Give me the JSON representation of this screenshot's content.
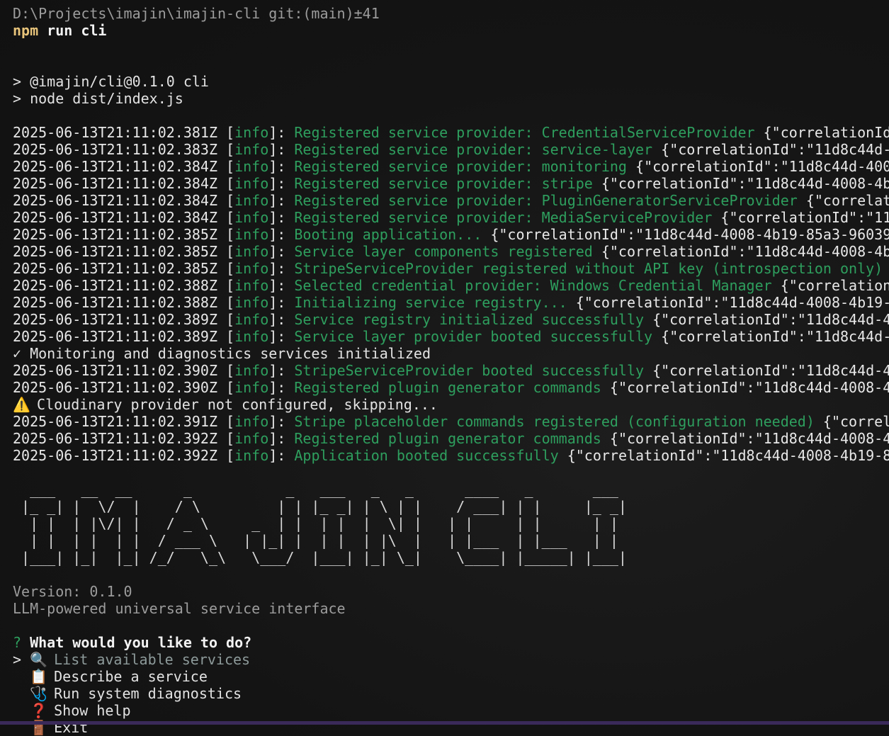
{
  "prompt": {
    "path": "D:\\Projects\\imajin\\imajin-cli git:(main)±41",
    "command_bin": "npm",
    "command_args": " run cli"
  },
  "npm_output": [
    "> @imajin/cli@0.1.0 cli",
    "> node dist/index.js"
  ],
  "logs": [
    {
      "ts": "2025-06-13T21:11:02.381Z",
      "level": "info",
      "msg": "Registered service provider: CredentialServiceProvider",
      "json": " {\"correlationId"
    },
    {
      "ts": "2025-06-13T21:11:02.383Z",
      "level": "info",
      "msg": "Registered service provider: service-layer",
      "json": " {\"correlationId\":\"11d8c44d-"
    },
    {
      "ts": "2025-06-13T21:11:02.384Z",
      "level": "info",
      "msg": "Registered service provider: monitoring",
      "json": " {\"correlationId\":\"11d8c44d-400"
    },
    {
      "ts": "2025-06-13T21:11:02.384Z",
      "level": "info",
      "msg": "Registered service provider: stripe",
      "json": " {\"correlationId\":\"11d8c44d-4008-4b"
    },
    {
      "ts": "2025-06-13T21:11:02.384Z",
      "level": "info",
      "msg": "Registered service provider: PluginGeneratorServiceProvider",
      "json": " {\"correlat"
    },
    {
      "ts": "2025-06-13T21:11:02.384Z",
      "level": "info",
      "msg": "Registered service provider: MediaServiceProvider",
      "json": " {\"correlationId\":\"11"
    },
    {
      "ts": "2025-06-13T21:11:02.385Z",
      "level": "info",
      "msg": "Booting application...",
      "json": " {\"correlationId\":\"11d8c44d-4008-4b19-85a3-96039"
    },
    {
      "ts": "2025-06-13T21:11:02.385Z",
      "level": "info",
      "msg": "Service layer components registered",
      "json": " {\"correlationId\":\"11d8c44d-4008-4b"
    },
    {
      "ts": "2025-06-13T21:11:02.385Z",
      "level": "info",
      "msg": "StripeServiceProvider registered without API key (introspection only)",
      "json": " {"
    },
    {
      "ts": "2025-06-13T21:11:02.388Z",
      "level": "info",
      "msg": "Selected credential provider: Windows Credential Manager",
      "json": " {\"correlation"
    },
    {
      "ts": "2025-06-13T21:11:02.388Z",
      "level": "info",
      "msg": "Initializing service registry...",
      "json": " {\"correlationId\":\"11d8c44d-4008-4b19-"
    },
    {
      "ts": "2025-06-13T21:11:02.389Z",
      "level": "info",
      "msg": "Service registry initialized successfully",
      "json": " {\"correlationId\":\"11d8c44d-4"
    },
    {
      "ts": "2025-06-13T21:11:02.389Z",
      "level": "info",
      "msg": "Service layer provider booted successfully",
      "json": " {\"correlationId\":\"11d8c44d-"
    }
  ],
  "monitor_line": "✓ Monitoring and diagnostics services initialized",
  "logs2": [
    {
      "ts": "2025-06-13T21:11:02.390Z",
      "level": "info",
      "msg": "StripeServiceProvider booted successfully",
      "json": " {\"correlationId\":\"11d8c44d-4"
    },
    {
      "ts": "2025-06-13T21:11:02.390Z",
      "level": "info",
      "msg": "Registered plugin generator commands",
      "json": " {\"correlationId\":\"11d8c44d-4008-4"
    }
  ],
  "warning_icon": "⚠️",
  "warning_text": " Cloudinary provider not configured, skipping...",
  "logs3": [
    {
      "ts": "2025-06-13T21:11:02.391Z",
      "level": "info",
      "msg": "Stripe placeholder commands registered (configuration needed)",
      "json": " {\"correl"
    },
    {
      "ts": "2025-06-13T21:11:02.392Z",
      "level": "info",
      "msg": "Registered plugin generator commands",
      "json": " {\"correlationId\":\"11d8c44d-4008-4"
    },
    {
      "ts": "2025-06-13T21:11:02.392Z",
      "level": "info",
      "msg": "Application booted successfully",
      "json": " {\"correlationId\":\"11d8c44d-4008-4b19-8"
    }
  ],
  "banner_lines": [
    "  ___   __  __      _           _   ___   _   _      ____   _       ___ ",
    " |_ _| |  \\/  |    / \\         | | |_ _| | \\ | |    / ___| | |     |_ _|",
    "  | |  | |\\/| |   / _ \\     _  | |  | |  |  \\| |   | |     | |      | | ",
    "  | |  | |  | |  / ___ \\   | |_| |  | |  | |\\  |   | |___  | |___   | | ",
    " |___| |_|  |_| /_/   \\_\\   \\___/  |___| |_| \\_|    \\____| |_____| |___|"
  ],
  "version": "Version: 0.1.0",
  "tagline": "LLM-powered universal service interface",
  "question_mark": "?",
  "question": " What would you like to do?",
  "menu": [
    {
      "pointer": ">",
      "icon": "🔍",
      "icon_name": "magnifier-icon",
      "label": "List available services",
      "selected": true
    },
    {
      "pointer": " ",
      "icon": "📋",
      "icon_name": "clipboard-icon",
      "label": "Describe a service",
      "selected": false
    },
    {
      "pointer": " ",
      "icon": "🩺",
      "icon_name": "stethoscope-icon",
      "label": "Run system diagnostics",
      "selected": false
    },
    {
      "pointer": " ",
      "icon": "❓",
      "icon_name": "question-icon",
      "label": "Show help",
      "selected": false
    },
    {
      "pointer": " ",
      "icon": "🚪",
      "icon_name": "door-icon",
      "label": "Exit",
      "selected": false
    }
  ]
}
